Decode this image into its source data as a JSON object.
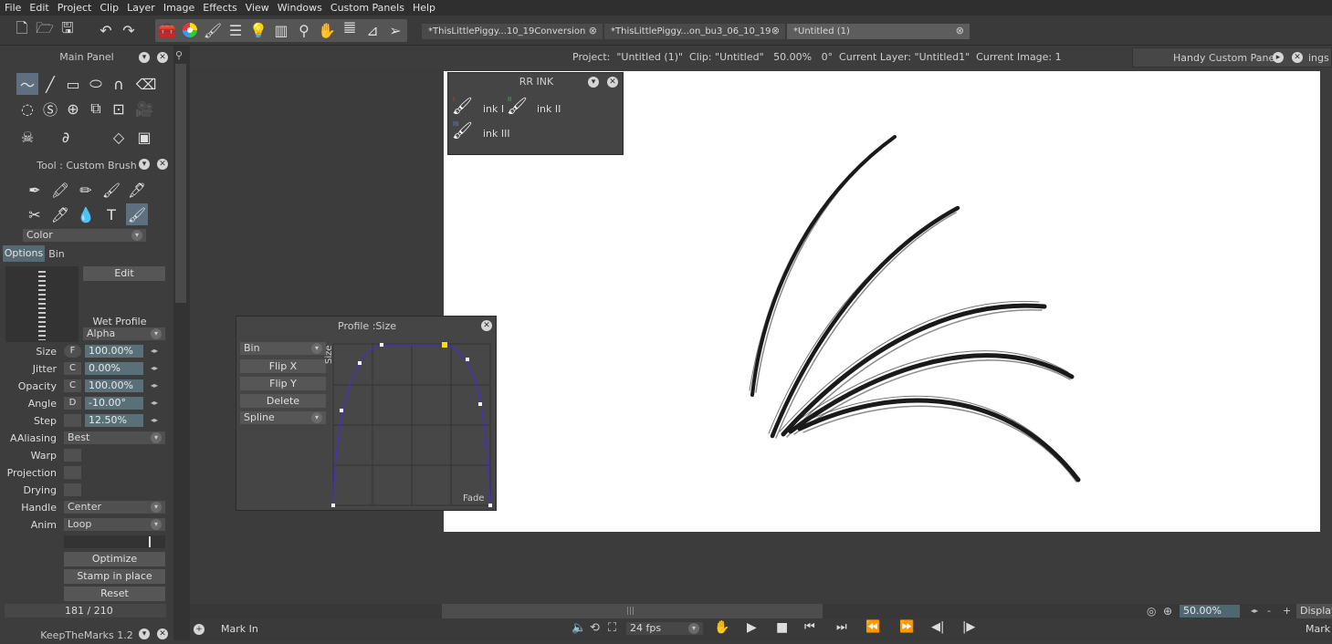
{
  "menu": [
    "File",
    "Edit",
    "Project",
    "Clip",
    "Layer",
    "Image",
    "Effects",
    "View",
    "Windows",
    "Custom Panels",
    "Help"
  ],
  "tabs": [
    {
      "label": "*ThisLittlePiggy...10_19Conversion",
      "close": "⊗"
    },
    {
      "label": "*ThisLittlePiggy...on_bu3_06_10_19",
      "close": "⊗"
    },
    {
      "label": "*Untitled (1)",
      "close": "⊗"
    }
  ],
  "info": {
    "text": "Project:  \"Untitled (1)\"  Clip: \"Untitled\"   50.00%   0°  Current Layer: \"Untitled1\"  Current Image: 1"
  },
  "handy": {
    "title": "Handy Custom Pane",
    "extra": "ings"
  },
  "main_panel": {
    "title": "Main Panel"
  },
  "tool_panel": {
    "title": "Tool : Custom Brush",
    "color_drop": "Color",
    "tab_options": "Options",
    "tab_bin": "Bin",
    "edit": "Edit",
    "wet_profile": "Wet Profile",
    "alpha": "Alpha"
  },
  "params": [
    {
      "label": "Size",
      "mode": "F",
      "value": "100.00%"
    },
    {
      "label": "Jitter",
      "mode": "C",
      "value": "0.00%"
    },
    {
      "label": "Opacity",
      "mode": "C",
      "value": "100.00%"
    },
    {
      "label": "Angle",
      "mode": "D",
      "value": "-10.00°"
    },
    {
      "label": "Step",
      "mode": "",
      "value": "12.50%"
    }
  ],
  "aaliasing": {
    "label": "AAliasing",
    "value": "Best"
  },
  "checks": [
    "Warp",
    "Projection",
    "Drying"
  ],
  "handle": {
    "label": "Handle",
    "value": "Center"
  },
  "anim": {
    "label": "Anim",
    "value": "Loop"
  },
  "buttons": {
    "optimize": "Optimize",
    "stamp": "Stamp in place",
    "reset": "Reset"
  },
  "count": "181 / 210",
  "keep": {
    "title": "KeepTheMarks 1.2"
  },
  "rrink": {
    "title": "RR INK",
    "items": [
      "ink I",
      "ink II",
      "ink III"
    ],
    "tags": [
      "I",
      "II",
      "III"
    ]
  },
  "profile": {
    "title": "Profile :Size",
    "bin": "Bin",
    "flipx": "Flip X",
    "flipy": "Flip Y",
    "delete": "Delete",
    "spline": "Spline",
    "ylabel": "Size",
    "xlabel": "Fade"
  },
  "bottom": {
    "mark_in": "Mark In",
    "fps": "24 fps",
    "mark": "Mark"
  },
  "zoom": {
    "value": "50.00%",
    "display": "Display",
    "minus": "-",
    "plus": "+"
  },
  "colors": {
    "accent": "#597078",
    "curve": "#4b2dbb",
    "handle": "#f5e400"
  }
}
